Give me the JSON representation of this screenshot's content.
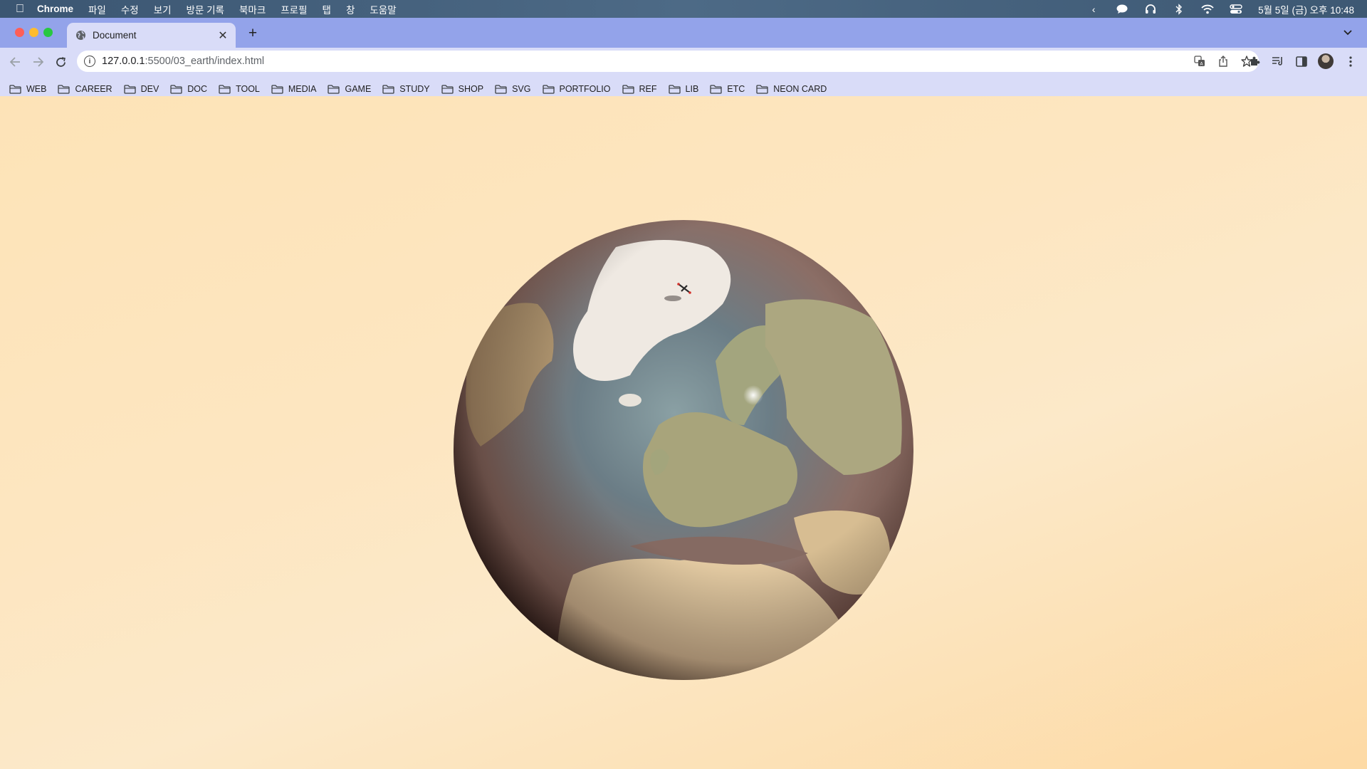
{
  "menubar": {
    "app_name": "Chrome",
    "menus": [
      "파일",
      "수정",
      "보기",
      "방문 기록",
      "북마크",
      "프로필",
      "탭",
      "창",
      "도움말"
    ],
    "clock": "5월 5일 (금) 오후 10:48",
    "tray_icons": [
      "chevron-left-icon",
      "messages-icon",
      "headphones-icon",
      "bluetooth-icon",
      "wifi-icon",
      "control-center-icon"
    ]
  },
  "tab": {
    "title": "Document"
  },
  "address_bar": {
    "host": "127.0.0.1",
    "path": ":5500/03_earth/index.html"
  },
  "bookmarks": [
    "WEB",
    "CAREER",
    "DEV",
    "DOC",
    "TOOL",
    "MEDIA",
    "GAME",
    "STUDY",
    "SHOP",
    "SVG",
    "PORTFOLIO",
    "REF",
    "LIB",
    "ETC",
    "NEON CARD"
  ],
  "colors": {
    "tabstrip": "#93a3ea",
    "toolbar": "#d9dcf8",
    "page_background": "#fde3b7"
  }
}
